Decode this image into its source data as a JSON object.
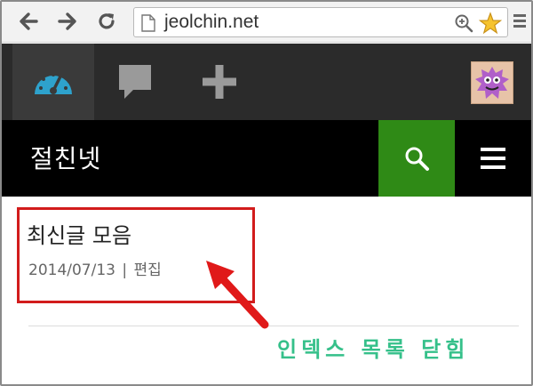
{
  "browser": {
    "url": "jeolchin.net",
    "icons": {
      "back": "back-arrow-icon",
      "forward": "forward-arrow-icon",
      "reload": "reload-icon",
      "page": "page-icon",
      "zoom": "zoom-icon",
      "bookmark": "star-icon",
      "menu": "chrome-menu-icon"
    }
  },
  "admin_bar": {
    "items": [
      "dashboard-icon",
      "comments-icon",
      "new-post-icon",
      "avatar"
    ]
  },
  "site": {
    "title": "절친넷"
  },
  "post": {
    "title": "최신글 모음",
    "date": "2014/07/13",
    "separator": "|",
    "edit_label": "편집"
  },
  "annotation": {
    "text": "인덱스 목록 닫힘",
    "color": "#35c08a"
  },
  "colors": {
    "search_green": "#2f8a16",
    "highlight_red": "#d21c1c",
    "admin_bar": "#2b2b2b",
    "dashboard_blue": "#2ea2cc"
  }
}
